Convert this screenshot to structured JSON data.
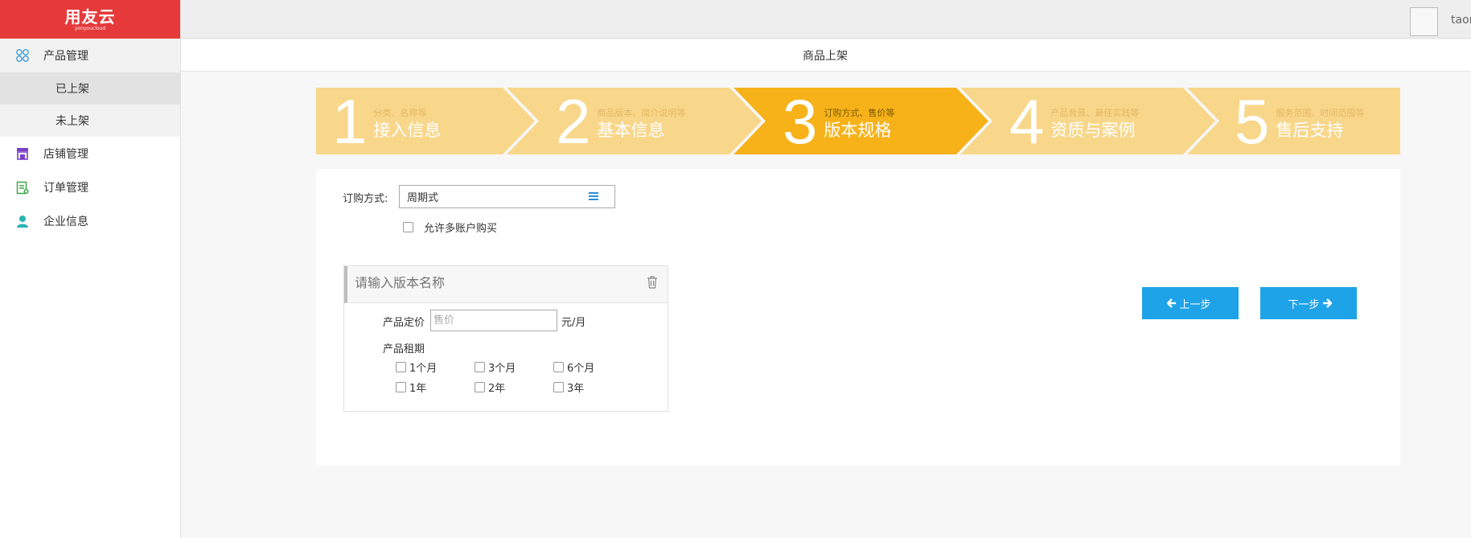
{
  "brand": {
    "logo_text": "用友云",
    "logo_sub": "yonyoucloud",
    "color": "#e63a3a"
  },
  "topbar": {
    "username": "taor"
  },
  "sidebar": {
    "groups": [
      {
        "label": "产品管理",
        "icon": "product-management-icon",
        "children": [
          "已上架",
          "未上架"
        ]
      },
      {
        "label": "店铺管理",
        "icon": "store-icon"
      },
      {
        "label": "订单管理",
        "icon": "order-icon"
      },
      {
        "label": "企业信息",
        "icon": "enterprise-user-icon"
      }
    ],
    "selected_child": "已上架"
  },
  "page": {
    "title": "商品上架"
  },
  "steps": [
    {
      "num": "1",
      "hint": "分类、名称等",
      "title": "接入信息"
    },
    {
      "num": "2",
      "hint": "商品版本、简介说明等",
      "title": "基本信息"
    },
    {
      "num": "3",
      "hint": "订购方式、售价等",
      "title": "版本规格"
    },
    {
      "num": "4",
      "hint": "产品背景、最佳实践等",
      "title": "资质与案例"
    },
    {
      "num": "5",
      "hint": "服务范围、时间范围等",
      "title": "售后支持"
    }
  ],
  "active_step": 3,
  "form": {
    "order_method_label": "订购方式:",
    "order_method_value": "周期式",
    "allow_multi_account_label": "允许多账户购买",
    "version": {
      "name_placeholder": "请输入版本名称",
      "price_label": "产品定价",
      "price_placeholder": "售价",
      "price_unit": "元/月",
      "period_label": "产品租期",
      "periods": [
        "1个月",
        "3个月",
        "6个月",
        "1年",
        "2年",
        "3年"
      ]
    }
  },
  "buttons": {
    "prev": "上一步",
    "next": "下一步"
  },
  "colors": {
    "step_inactive": "#f8d78b",
    "step_active": "#f7b21a",
    "button": "#1ea3e8"
  }
}
